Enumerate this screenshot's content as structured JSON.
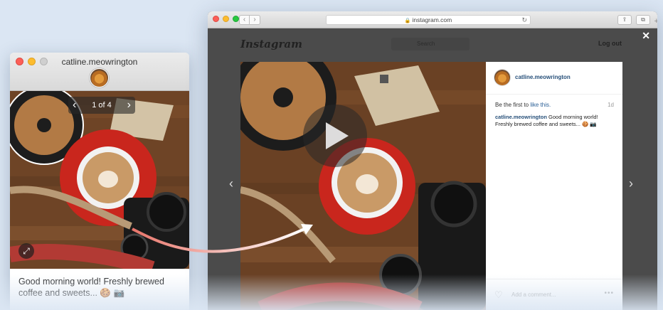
{
  "mini_window": {
    "title": "catline.meowrington",
    "pager": {
      "text": "1 of 4",
      "prev_icon": "‹",
      "next_icon": "›"
    },
    "expand_icon": "⤢",
    "caption": "Good morning world! Freshly brewed coffee and sweets... 🍪 📷"
  },
  "browser": {
    "url": "instagram.com",
    "reload_icon": "↻",
    "back_icon": "‹",
    "forward_icon": "›",
    "share_icon": "⇪",
    "tabs_icon": "⧉",
    "new_tab_icon": "+"
  },
  "instagram": {
    "logo": "Instagram",
    "search_placeholder": "Search",
    "logout": "Log out",
    "close_icon": "✕",
    "prev_icon": "‹",
    "next_icon": "›",
    "post": {
      "username": "catline.meowrington",
      "likes_prefix": "Be the first to ",
      "likes_link": "like this.",
      "age": "1d",
      "caption_user": "catline.meowrington",
      "caption_text": " Good morning world! Freshly brewed coffee and sweets... 🍪 📷",
      "comment_placeholder": "Add a comment...",
      "heart_icon": "♡",
      "more_icon": "•••"
    }
  },
  "colors": {
    "background": "#dbe6f3",
    "browser_dark": "#4b4b4b",
    "link": "#27507a",
    "mug": "#d8322a"
  }
}
